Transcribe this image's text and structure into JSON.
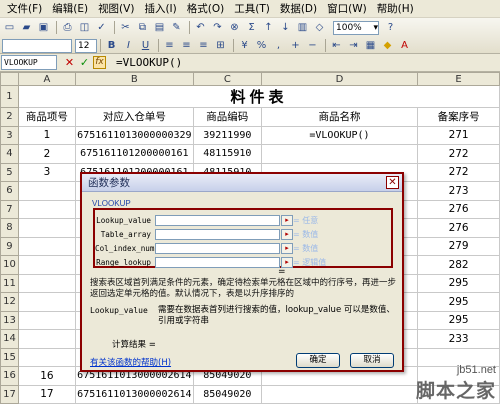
{
  "menu": [
    "文件(F)",
    "编辑(E)",
    "视图(V)",
    "插入(I)",
    "格式(O)",
    "工具(T)",
    "数据(D)",
    "窗口(W)",
    "帮助(H)"
  ],
  "toolbar": {
    "zoom": "100%",
    "font_size": "12"
  },
  "formula_bar": {
    "name_box": "VLOOKUP",
    "cancel_icon": "✕",
    "enter_icon": "✓",
    "fx_label": "fx",
    "formula": "=VLOOKUP()"
  },
  "sheet": {
    "column_headers": [
      "A",
      "B",
      "C",
      "D",
      "E"
    ],
    "title": "料件表",
    "headers": [
      "商品项号",
      "对应入仓单号",
      "商品编码",
      "商品名称",
      "备案序号"
    ],
    "rows": [
      {
        "row": "3",
        "a": "1",
        "b": "6751611013000000329",
        "c": "39211990",
        "d": "=VLOOKUP()",
        "e": "271"
      },
      {
        "row": "4",
        "a": "2",
        "b": "675161101200000161",
        "c": "48115910",
        "d": "",
        "e": "272"
      },
      {
        "row": "5",
        "a": "3",
        "b": "675161101200000161",
        "c": "48115910",
        "d": "",
        "e": "272"
      },
      {
        "row": "6",
        "a": "",
        "b": "",
        "c": "",
        "d": "",
        "e": "273"
      },
      {
        "row": "7",
        "a": "",
        "b": "",
        "c": "",
        "d": "",
        "e": "276"
      },
      {
        "row": "8",
        "a": "",
        "b": "",
        "c": "",
        "d": "",
        "e": "276"
      },
      {
        "row": "9",
        "a": "",
        "b": "",
        "c": "",
        "d": "",
        "e": "279"
      },
      {
        "row": "10",
        "a": "",
        "b": "",
        "c": "",
        "d": "",
        "e": "282"
      },
      {
        "row": "11",
        "a": "",
        "b": "",
        "c": "",
        "d": "",
        "e": "295"
      },
      {
        "row": "12",
        "a": "",
        "b": "",
        "c": "",
        "d": "",
        "e": "295"
      },
      {
        "row": "13",
        "a": "",
        "b": "",
        "c": "",
        "d": "",
        "e": "295"
      },
      {
        "row": "14",
        "a": "",
        "b": "",
        "c": "",
        "d": "",
        "e": "233"
      },
      {
        "row": "15",
        "a": "",
        "b": "",
        "c": "",
        "d": "",
        "e": ""
      },
      {
        "row": "16",
        "a": "16",
        "b": "6751611013000002614",
        "c": "85049020",
        "d": "",
        "e": ""
      },
      {
        "row": "17",
        "a": "17",
        "b": "6751611013000002614",
        "c": "85049020",
        "d": "",
        "e": ""
      }
    ]
  },
  "dialog": {
    "title": "函数参数",
    "close_icon": "✕",
    "function_name": "VLOOKUP",
    "args": [
      {
        "label": "Lookup_value",
        "hint": "= 任意"
      },
      {
        "label": "Table_array",
        "hint": "= 数值"
      },
      {
        "label": "Col_index_num",
        "hint": "= 数值"
      },
      {
        "label": "Range_lookup",
        "hint": "= 逻辑值"
      }
    ],
    "result_eq": "=",
    "description": "搜索表区域首列满足条件的元素，确定待检索单元格在区域中的行序号，再进一步返回选定单元格的值。默认情况下，表是以升序排序的",
    "arg_desc_key": "Lookup_value",
    "arg_desc_text": "需要在数据表首列进行搜索的值，lookup_value 可以是数值、引用或字符串",
    "calc_result": "计算结果 =",
    "help_link": "有关该函数的帮助(H)",
    "ok_label": "确定",
    "cancel_label": "取消"
  },
  "watermark": {
    "site": "jb51.net",
    "name": "脚本之家"
  },
  "colors": {
    "highlight_border": "#8b0000",
    "chrome": "#ECE9D8"
  }
}
